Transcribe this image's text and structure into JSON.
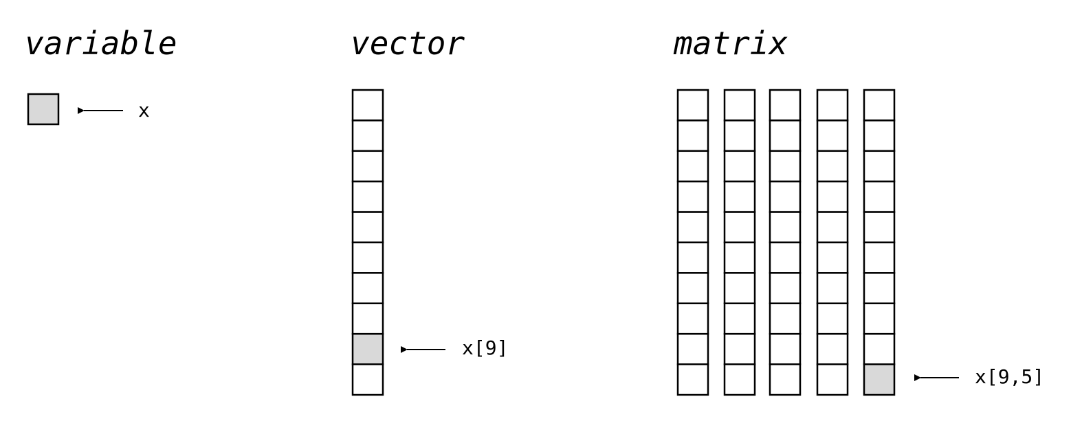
{
  "titles": {
    "variable": "variable",
    "vector": "vector",
    "matrix": "matrix"
  },
  "variable": {
    "label": "x",
    "highlighted": true
  },
  "vector": {
    "length": 10,
    "highlight_index": 9,
    "label": "x[9]"
  },
  "matrix": {
    "rows": 10,
    "cols": 5,
    "highlight_row": 10,
    "highlight_col": 5,
    "label": "x[9,5]"
  },
  "colors": {
    "cell_fill": "#ffffff",
    "highlight_fill": "#d9d9d9",
    "stroke": "#000000"
  }
}
